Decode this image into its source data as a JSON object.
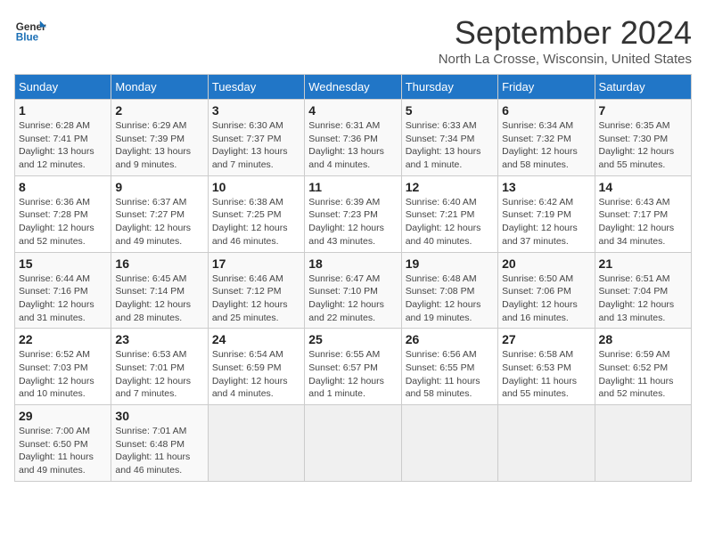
{
  "logo": {
    "text_general": "General",
    "text_blue": "Blue"
  },
  "title": "September 2024",
  "subtitle": "North La Crosse, Wisconsin, United States",
  "days_of_week": [
    "Sunday",
    "Monday",
    "Tuesday",
    "Wednesday",
    "Thursday",
    "Friday",
    "Saturday"
  ],
  "weeks": [
    [
      {
        "day": "1",
        "sunrise": "6:28 AM",
        "sunset": "7:41 PM",
        "daylight": "13 hours and 12 minutes."
      },
      {
        "day": "2",
        "sunrise": "6:29 AM",
        "sunset": "7:39 PM",
        "daylight": "13 hours and 9 minutes."
      },
      {
        "day": "3",
        "sunrise": "6:30 AM",
        "sunset": "7:37 PM",
        "daylight": "13 hours and 7 minutes."
      },
      {
        "day": "4",
        "sunrise": "6:31 AM",
        "sunset": "7:36 PM",
        "daylight": "13 hours and 4 minutes."
      },
      {
        "day": "5",
        "sunrise": "6:33 AM",
        "sunset": "7:34 PM",
        "daylight": "13 hours and 1 minute."
      },
      {
        "day": "6",
        "sunrise": "6:34 AM",
        "sunset": "7:32 PM",
        "daylight": "12 hours and 58 minutes."
      },
      {
        "day": "7",
        "sunrise": "6:35 AM",
        "sunset": "7:30 PM",
        "daylight": "12 hours and 55 minutes."
      }
    ],
    [
      {
        "day": "8",
        "sunrise": "6:36 AM",
        "sunset": "7:28 PM",
        "daylight": "12 hours and 52 minutes."
      },
      {
        "day": "9",
        "sunrise": "6:37 AM",
        "sunset": "7:27 PM",
        "daylight": "12 hours and 49 minutes."
      },
      {
        "day": "10",
        "sunrise": "6:38 AM",
        "sunset": "7:25 PM",
        "daylight": "12 hours and 46 minutes."
      },
      {
        "day": "11",
        "sunrise": "6:39 AM",
        "sunset": "7:23 PM",
        "daylight": "12 hours and 43 minutes."
      },
      {
        "day": "12",
        "sunrise": "6:40 AM",
        "sunset": "7:21 PM",
        "daylight": "12 hours and 40 minutes."
      },
      {
        "day": "13",
        "sunrise": "6:42 AM",
        "sunset": "7:19 PM",
        "daylight": "12 hours and 37 minutes."
      },
      {
        "day": "14",
        "sunrise": "6:43 AM",
        "sunset": "7:17 PM",
        "daylight": "12 hours and 34 minutes."
      }
    ],
    [
      {
        "day": "15",
        "sunrise": "6:44 AM",
        "sunset": "7:16 PM",
        "daylight": "12 hours and 31 minutes."
      },
      {
        "day": "16",
        "sunrise": "6:45 AM",
        "sunset": "7:14 PM",
        "daylight": "12 hours and 28 minutes."
      },
      {
        "day": "17",
        "sunrise": "6:46 AM",
        "sunset": "7:12 PM",
        "daylight": "12 hours and 25 minutes."
      },
      {
        "day": "18",
        "sunrise": "6:47 AM",
        "sunset": "7:10 PM",
        "daylight": "12 hours and 22 minutes."
      },
      {
        "day": "19",
        "sunrise": "6:48 AM",
        "sunset": "7:08 PM",
        "daylight": "12 hours and 19 minutes."
      },
      {
        "day": "20",
        "sunrise": "6:50 AM",
        "sunset": "7:06 PM",
        "daylight": "12 hours and 16 minutes."
      },
      {
        "day": "21",
        "sunrise": "6:51 AM",
        "sunset": "7:04 PM",
        "daylight": "12 hours and 13 minutes."
      }
    ],
    [
      {
        "day": "22",
        "sunrise": "6:52 AM",
        "sunset": "7:03 PM",
        "daylight": "12 hours and 10 minutes."
      },
      {
        "day": "23",
        "sunrise": "6:53 AM",
        "sunset": "7:01 PM",
        "daylight": "12 hours and 7 minutes."
      },
      {
        "day": "24",
        "sunrise": "6:54 AM",
        "sunset": "6:59 PM",
        "daylight": "12 hours and 4 minutes."
      },
      {
        "day": "25",
        "sunrise": "6:55 AM",
        "sunset": "6:57 PM",
        "daylight": "12 hours and 1 minute."
      },
      {
        "day": "26",
        "sunrise": "6:56 AM",
        "sunset": "6:55 PM",
        "daylight": "11 hours and 58 minutes."
      },
      {
        "day": "27",
        "sunrise": "6:58 AM",
        "sunset": "6:53 PM",
        "daylight": "11 hours and 55 minutes."
      },
      {
        "day": "28",
        "sunrise": "6:59 AM",
        "sunset": "6:52 PM",
        "daylight": "11 hours and 52 minutes."
      }
    ],
    [
      {
        "day": "29",
        "sunrise": "7:00 AM",
        "sunset": "6:50 PM",
        "daylight": "11 hours and 49 minutes."
      },
      {
        "day": "30",
        "sunrise": "7:01 AM",
        "sunset": "6:48 PM",
        "daylight": "11 hours and 46 minutes."
      },
      null,
      null,
      null,
      null,
      null
    ]
  ],
  "labels": {
    "sunrise": "Sunrise:",
    "sunset": "Sunset:",
    "daylight": "Daylight:"
  }
}
